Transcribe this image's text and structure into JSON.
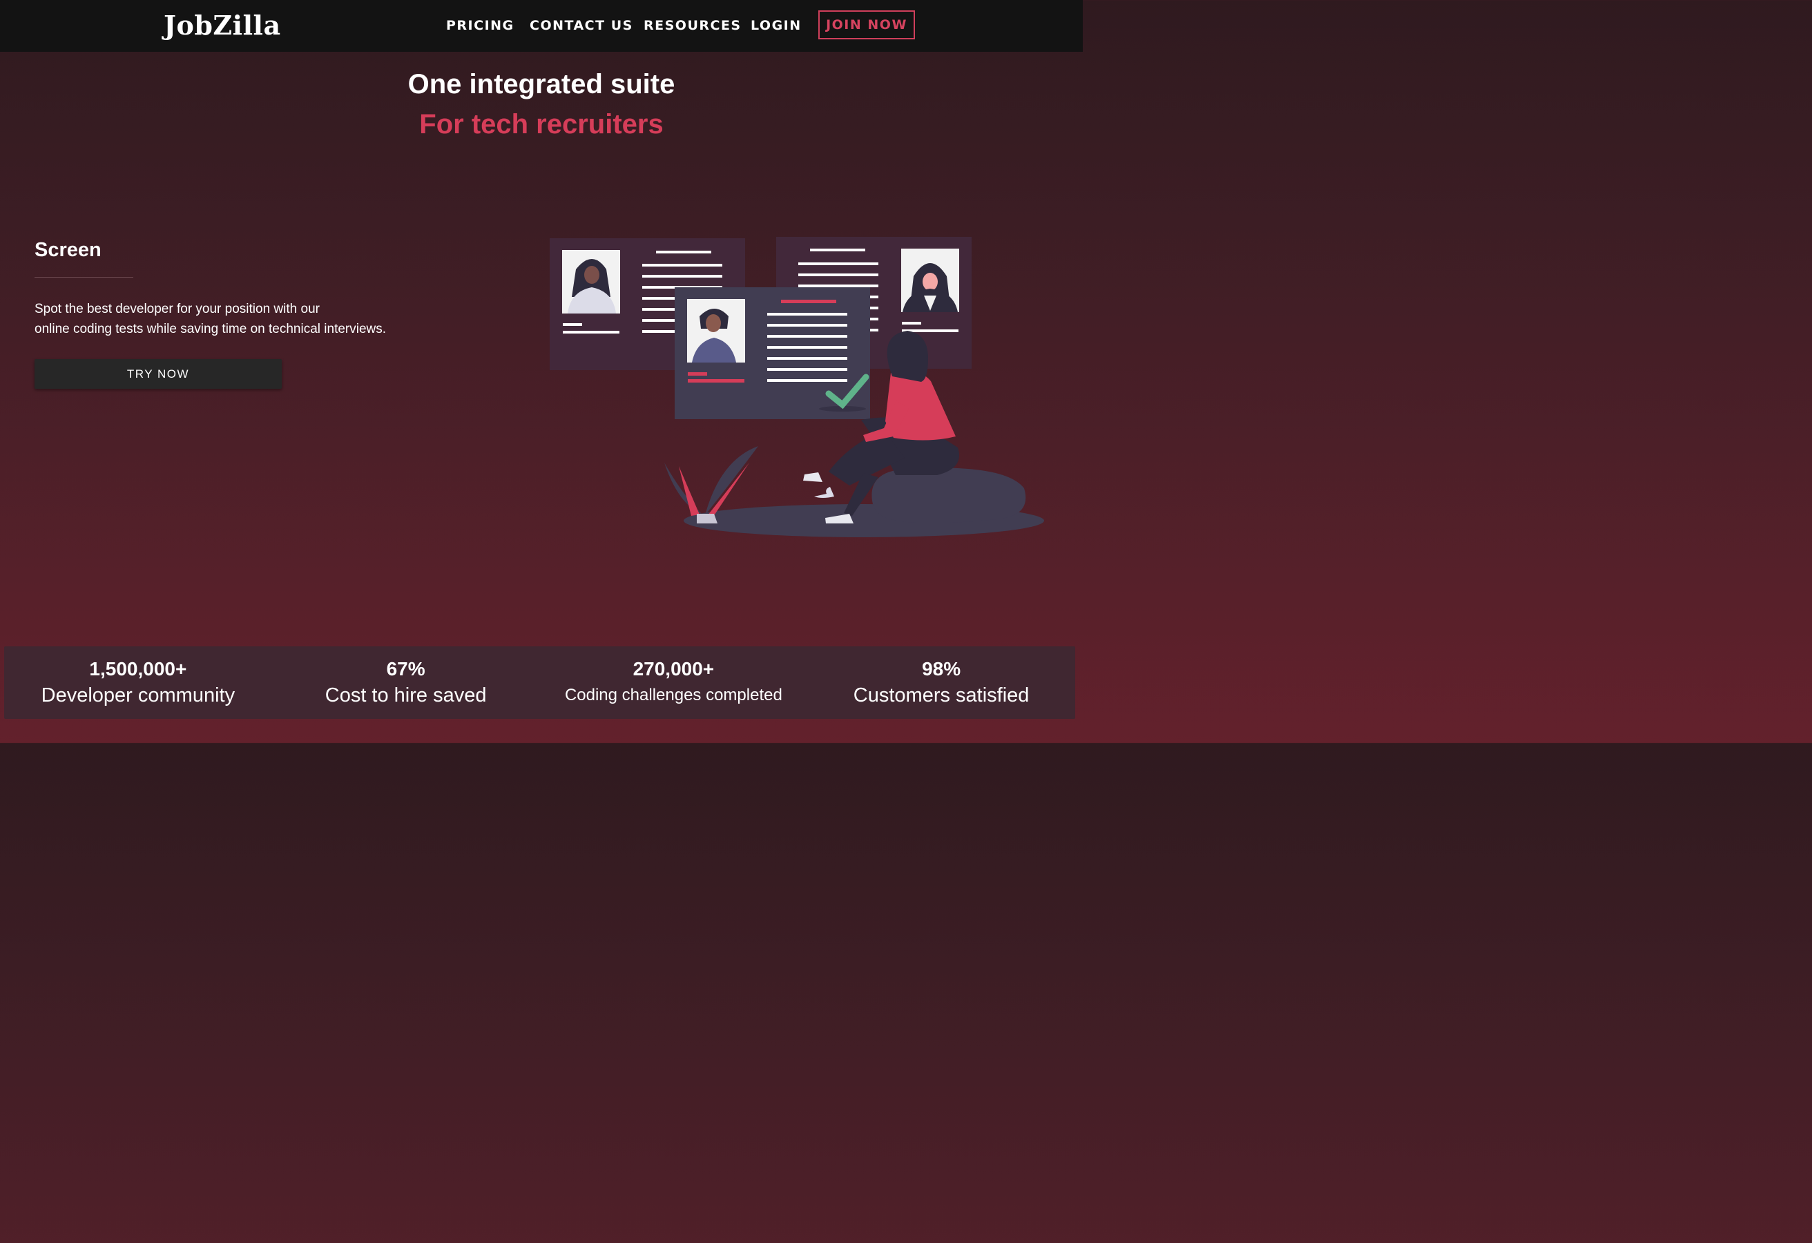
{
  "header": {
    "brand": "JobZilla",
    "nav": [
      "PRICING",
      "CONTACT US",
      "RESOURCES",
      "LOGIN"
    ],
    "cta": "JOIN NOW"
  },
  "hero": {
    "title": "One integrated suite",
    "subtitle": "For tech recruiters"
  },
  "feature": {
    "title": "Screen",
    "description_line1": "Spot the best developer for your position with our",
    "description_line2": "online coding tests while saving time on technical interviews.",
    "button": "TRY NOW"
  },
  "stats": [
    {
      "value": "1,500,000+",
      "label": "Developer community"
    },
    {
      "value": "67%",
      "label": "Cost to hire saved"
    },
    {
      "value": "270,000+",
      "label": "Coding challenges completed"
    },
    {
      "value": "98%",
      "label": "Customers satisfied"
    }
  ],
  "colors": {
    "accent": "#d63d59",
    "navbar": "#131313",
    "panel": "#413d52",
    "check": "#5fb38a"
  },
  "icons": [
    "candidate-illustration",
    "checkmark-icon",
    "plant-icon"
  ]
}
